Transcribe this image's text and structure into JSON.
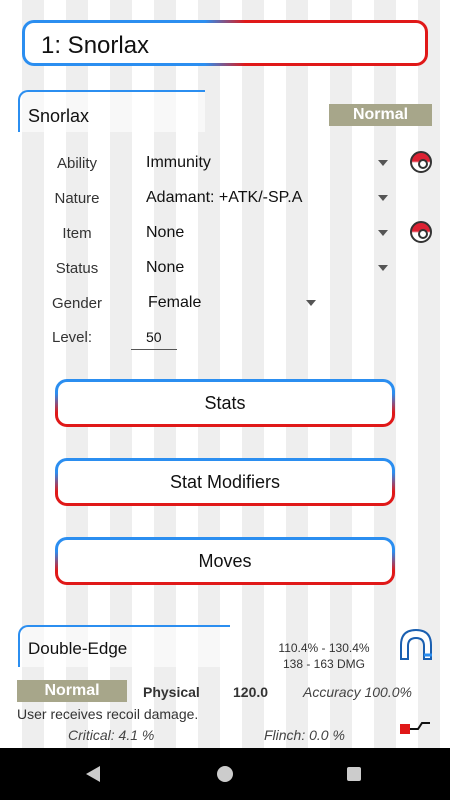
{
  "header": {
    "title": "1:  Snorlax"
  },
  "pokemon": {
    "name": "Snorlax",
    "type_badge": "Normal",
    "fields": {
      "ability_label": "Ability",
      "ability_value": "Immunity",
      "nature_label": "Nature",
      "nature_value": "Adamant:  +ATK/-SP.A",
      "item_label": "Item",
      "item_value": "None",
      "status_label": "Status",
      "status_value": "None",
      "gender_label": "Gender",
      "gender_value": "Female",
      "level_label": "Level:",
      "level_value": "50"
    }
  },
  "buttons": {
    "stats": "Stats",
    "stat_modifiers": "Stat Modifiers",
    "moves": "Moves"
  },
  "move": {
    "name": "Double-Edge",
    "damage_percent": "110.4% - 130.4%",
    "damage_dmg": "138 - 163 DMG",
    "type": "Normal",
    "category": "Physical",
    "power": "120.0",
    "accuracy": "Accuracy 100.0%",
    "description": "User receives recoil damage.",
    "critical": "Critical: 4.1 %",
    "flinch": "Flinch: 0.0 %"
  },
  "icons": {
    "ability_info": "pokeball-icon",
    "item_info": "pokeball-icon",
    "move_damage": "arch-icon",
    "move_detail": "rail-icon"
  },
  "colors": {
    "accent_blue": "#2b8ef0",
    "accent_red": "#e01818",
    "normal_type": "#a7a68a"
  }
}
